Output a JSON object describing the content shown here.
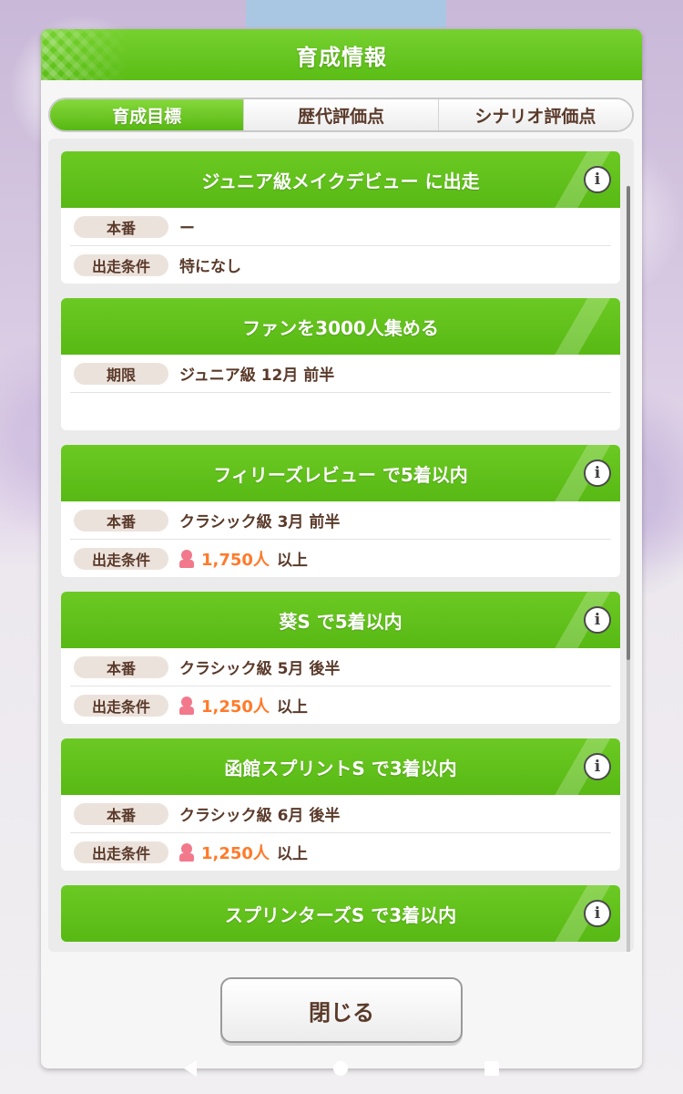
{
  "dialog": {
    "title": "育成情報",
    "close_label": "閉じる"
  },
  "tabs": [
    {
      "label": "育成目標",
      "active": true
    },
    {
      "label": "歴代評価点",
      "active": false
    },
    {
      "label": "シナリオ評価点",
      "active": false
    }
  ],
  "goals": [
    {
      "title": "ジュニア級メイクデビュー に出走",
      "has_info": true,
      "rows": [
        {
          "label": "本番",
          "value": "ー"
        },
        {
          "label": "出走条件",
          "value": "特になし"
        }
      ]
    },
    {
      "title": "ファンを3000人集める",
      "has_info": false,
      "rows": [
        {
          "label": "期限",
          "value": "ジュニア級 12月 前半"
        }
      ]
    },
    {
      "title": "フィリーズレビュー で5着以内",
      "has_info": true,
      "rows": [
        {
          "label": "本番",
          "value": "クラシック級 3月 前半"
        },
        {
          "label": "出走条件",
          "fans": "1,750人",
          "suffix": "以上"
        }
      ]
    },
    {
      "title": "葵S で5着以内",
      "has_info": true,
      "rows": [
        {
          "label": "本番",
          "value": "クラシック級 5月 後半"
        },
        {
          "label": "出走条件",
          "fans": "1,250人",
          "suffix": "以上"
        }
      ]
    },
    {
      "title": "函館スプリントS で3着以内",
      "has_info": true,
      "rows": [
        {
          "label": "本番",
          "value": "クラシック級 6月 後半"
        },
        {
          "label": "出走条件",
          "fans": "1,250人",
          "suffix": "以上"
        }
      ]
    },
    {
      "title": "スプリンターズS で3着以内",
      "has_info": true,
      "rows": []
    }
  ],
  "icons": {
    "info": "info-icon",
    "fan": "fan-person-icon",
    "back": "back-icon",
    "home": "home-icon",
    "recent": "recent-apps-icon"
  },
  "colors": {
    "accent_green": "#5bbd16",
    "fan_orange": "#ff7a2a",
    "text_brown": "#5a3a2a"
  }
}
